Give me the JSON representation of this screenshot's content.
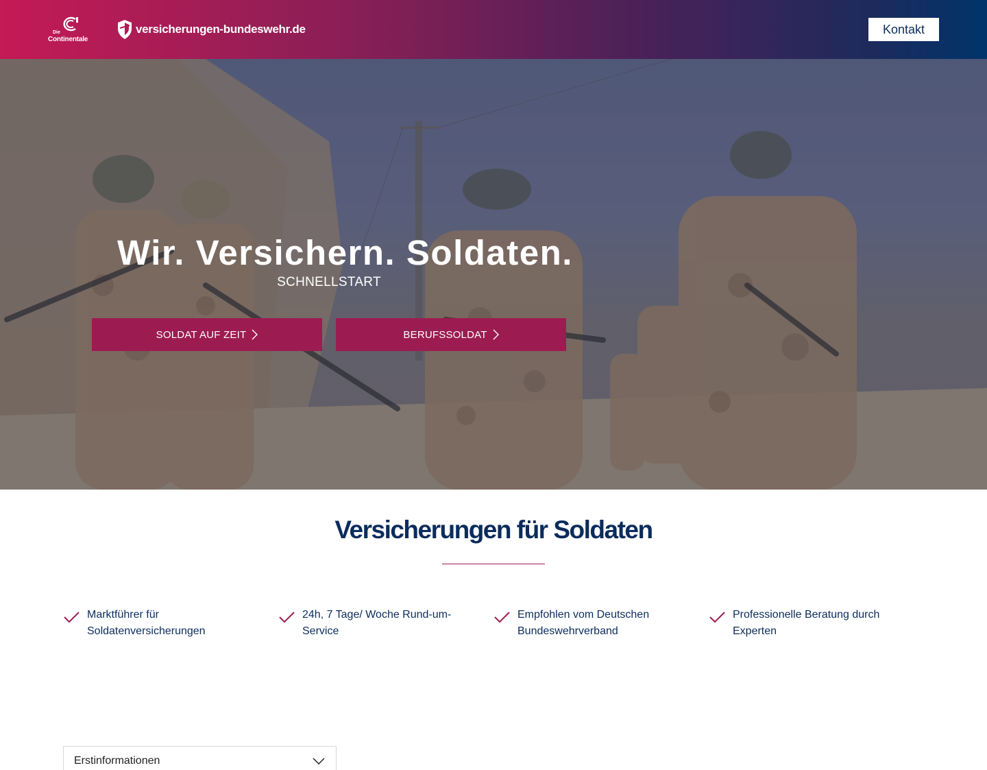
{
  "header": {
    "conti_logo_small": "Die",
    "conti_logo_name": "Continentale",
    "site_logo_text": "versicherungen-bundeswehr.de",
    "contact_label": "Kontakt"
  },
  "hero": {
    "title": "Wir. Versichern. Soldaten.",
    "subtitle": "SCHNELLSTART",
    "buttons": [
      {
        "label": "SOLDAT AUF ZEIT"
      },
      {
        "label": "BERUFSSOLDAT"
      }
    ]
  },
  "section": {
    "title": "Versicherungen für Soldaten",
    "features": [
      {
        "text": "Marktführer für Soldatenversicherungen"
      },
      {
        "text": "24h, 7 Tage/ Woche Rund-um-Service"
      },
      {
        "text": "Empfohlen vom Deutschen Bundeswehrverband"
      },
      {
        "text": "Professionelle Beratung durch Experten"
      }
    ]
  },
  "select": {
    "value": "Erstinformationen"
  },
  "colors": {
    "accent": "#9c1c51",
    "navy": "#0b2c5c",
    "header_gradient_start": "#c41a55",
    "header_gradient_end": "#00346b"
  },
  "icons": [
    "conti-logo-icon",
    "shield-icon",
    "chevron-right-icon",
    "check-icon",
    "chevron-down-icon"
  ]
}
